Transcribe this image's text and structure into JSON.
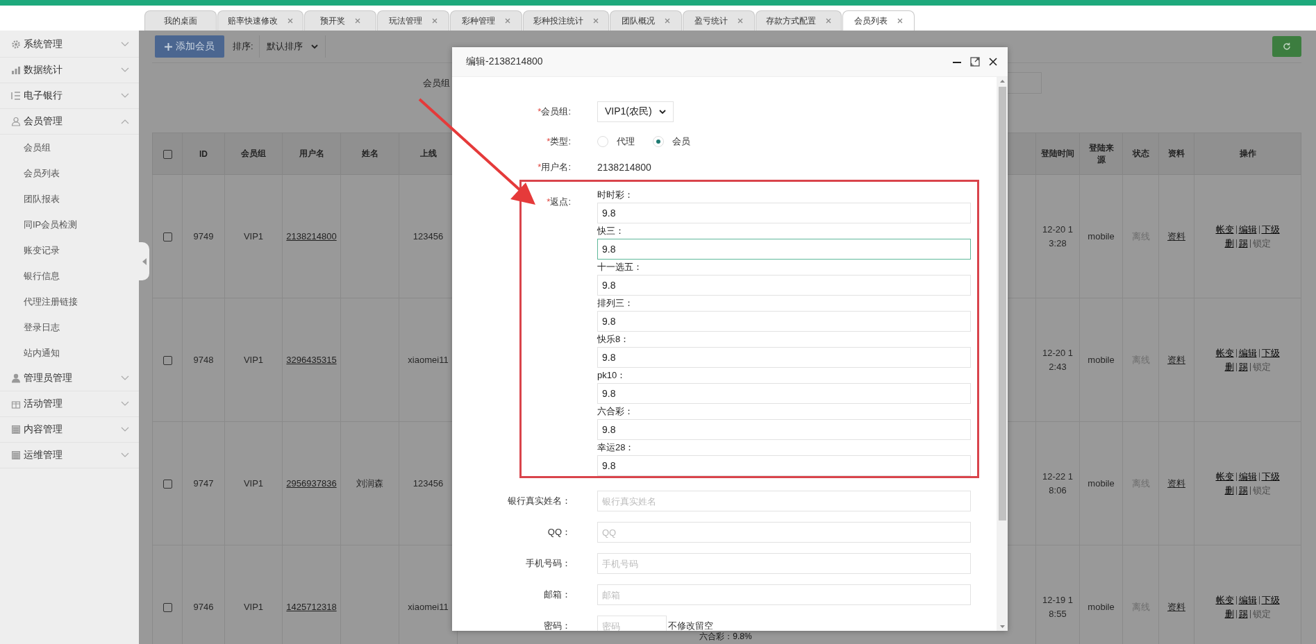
{
  "tabs": [
    {
      "label": "我的桌面",
      "closable": false,
      "selected": false
    },
    {
      "label": "赔率快速修改",
      "closable": true,
      "selected": false
    },
    {
      "label": "预开奖",
      "closable": true,
      "selected": false
    },
    {
      "label": "玩法管理",
      "closable": true,
      "selected": false
    },
    {
      "label": "彩种管理",
      "closable": true,
      "selected": false
    },
    {
      "label": "彩种投注统计",
      "closable": true,
      "selected": false
    },
    {
      "label": "团队概况",
      "closable": true,
      "selected": false
    },
    {
      "label": "盈亏统计",
      "closable": true,
      "selected": false
    },
    {
      "label": "存款方式配置",
      "closable": true,
      "selected": false
    },
    {
      "label": "会员列表",
      "closable": true,
      "selected": true
    }
  ],
  "sidebar": {
    "items": [
      {
        "label": "系统管理",
        "expanded": false
      },
      {
        "label": "数据统计",
        "expanded": false
      },
      {
        "label": "电子银行",
        "expanded": false
      },
      {
        "label": "会员管理",
        "expanded": true,
        "children": [
          {
            "label": "会员组"
          },
          {
            "label": "会员列表"
          },
          {
            "label": "团队报表"
          },
          {
            "label": "同IP会员检测"
          },
          {
            "label": "账变记录"
          },
          {
            "label": "银行信息"
          },
          {
            "label": "代理注册链接"
          },
          {
            "label": "登录日志"
          },
          {
            "label": "站内通知"
          }
        ]
      },
      {
        "label": "管理员管理",
        "expanded": false
      },
      {
        "label": "活动管理",
        "expanded": false
      },
      {
        "label": "内容管理",
        "expanded": false
      },
      {
        "label": "运维管理",
        "expanded": false
      }
    ]
  },
  "toolbar": {
    "add_button": "添加会员",
    "sort_label": "排序:",
    "sort_value": "默认排序"
  },
  "filter": {
    "group_label": "会员组"
  },
  "table": {
    "header_checked": false,
    "columns": [
      "ID",
      "会员组",
      "用户名",
      "姓名",
      "上线",
      "登陆时间",
      "登陆来源",
      "状态",
      "资料",
      "操作"
    ],
    "rows": [
      {
        "checked": false,
        "id": "9749",
        "group": "VIP1",
        "username": "2138214800",
        "name": "",
        "upline": "123456",
        "login_time": "12-20 13:28",
        "login_source": "mobile",
        "status": "离线",
        "profile": "资料",
        "actions": [
          [
            {
              "label": "帐变",
              "disabled": false
            },
            {
              "label": "编辑",
              "disabled": false
            },
            {
              "label": "下级",
              "disabled": false
            }
          ],
          [
            {
              "label": "删",
              "disabled": false
            },
            {
              "label": "踢",
              "disabled": false
            },
            {
              "label": "锁定",
              "disabled": true
            }
          ]
        ]
      },
      {
        "checked": false,
        "id": "9748",
        "group": "VIP1",
        "username": "3296435315",
        "name": "",
        "upline": "xiaomei11",
        "login_time": "12-20 12:43",
        "login_source": "mobile",
        "status": "离线",
        "profile": "资料",
        "actions": [
          [
            {
              "label": "帐变",
              "disabled": false
            },
            {
              "label": "编辑",
              "disabled": false
            },
            {
              "label": "下级",
              "disabled": false
            }
          ],
          [
            {
              "label": "删",
              "disabled": false
            },
            {
              "label": "踢",
              "disabled": false
            },
            {
              "label": "锁定",
              "disabled": true
            }
          ]
        ]
      },
      {
        "checked": false,
        "id": "9747",
        "group": "VIP1",
        "username": "2956937836",
        "name": "刘润森",
        "upline": "123456",
        "login_time": "12-22 18:06",
        "login_source": "mobile",
        "status": "离线",
        "profile": "资料",
        "actions": [
          [
            {
              "label": "帐变",
              "disabled": false
            },
            {
              "label": "编辑",
              "disabled": false
            },
            {
              "label": "下级",
              "disabled": false
            }
          ],
          [
            {
              "label": "删",
              "disabled": false
            },
            {
              "label": "踢",
              "disabled": false
            },
            {
              "label": "锁定",
              "disabled": true
            }
          ]
        ]
      },
      {
        "checked": false,
        "id": "9746",
        "group": "VIP1",
        "username": "1425712318",
        "name": "",
        "upline": "xiaomei11",
        "column_6": "六合彩：9.8%",
        "login_time": "12-19 18:55",
        "login_source": "mobile",
        "status": "离线",
        "profile": "资料",
        "actions": [
          [
            {
              "label": "帐变",
              "disabled": false
            },
            {
              "label": "编辑",
              "disabled": false
            },
            {
              "label": "下级",
              "disabled": false
            }
          ],
          [
            {
              "label": "删",
              "disabled": false
            },
            {
              "label": "踢",
              "disabled": false
            },
            {
              "label": "锁定",
              "disabled": true
            }
          ]
        ]
      }
    ]
  },
  "modal": {
    "title": "编辑-2138214800",
    "fields": [
      {
        "kind": "select",
        "required_mark": "*",
        "label": "会员组:",
        "value": "VIP1(农民)"
      },
      {
        "kind": "radio",
        "required_mark": "*",
        "label": "类型:",
        "options": [
          {
            "label": "代理",
            "selected": false
          },
          {
            "label": "会员",
            "selected": true
          }
        ]
      },
      {
        "kind": "text",
        "required_mark": "*",
        "label": "用户名:",
        "value": "2138214800"
      },
      {
        "kind": "rebates",
        "required_mark": "*",
        "label": "返点:",
        "highlighted": true,
        "items": [
          {
            "label": "时时彩：",
            "value": "9.8",
            "focused": false
          },
          {
            "label": "快三：",
            "value": "9.8",
            "focused": true
          },
          {
            "label": "十一选五：",
            "value": "9.8",
            "focused": false
          },
          {
            "label": "排列三：",
            "value": "9.8",
            "focused": false
          },
          {
            "label": "快乐8：",
            "value": "9.8",
            "focused": false
          },
          {
            "label": "pk10：",
            "value": "9.8",
            "focused": false
          },
          {
            "label": "六合彩：",
            "value": "9.8",
            "focused": false
          },
          {
            "label": "幸运28：",
            "value": "9.8",
            "focused": false
          }
        ]
      },
      {
        "kind": "input",
        "label": "银行真实姓名：",
        "placeholder": "银行真实姓名"
      },
      {
        "kind": "input",
        "label": "QQ：",
        "placeholder": "QQ"
      },
      {
        "kind": "input",
        "label": "手机号码：",
        "placeholder": "手机号码"
      },
      {
        "kind": "input",
        "label": "邮箱：",
        "placeholder": "邮箱"
      },
      {
        "kind": "password",
        "label": "密码：",
        "placeholder": "密码",
        "hint": "不修改留空"
      }
    ]
  },
  "annotation_arrow": true
}
